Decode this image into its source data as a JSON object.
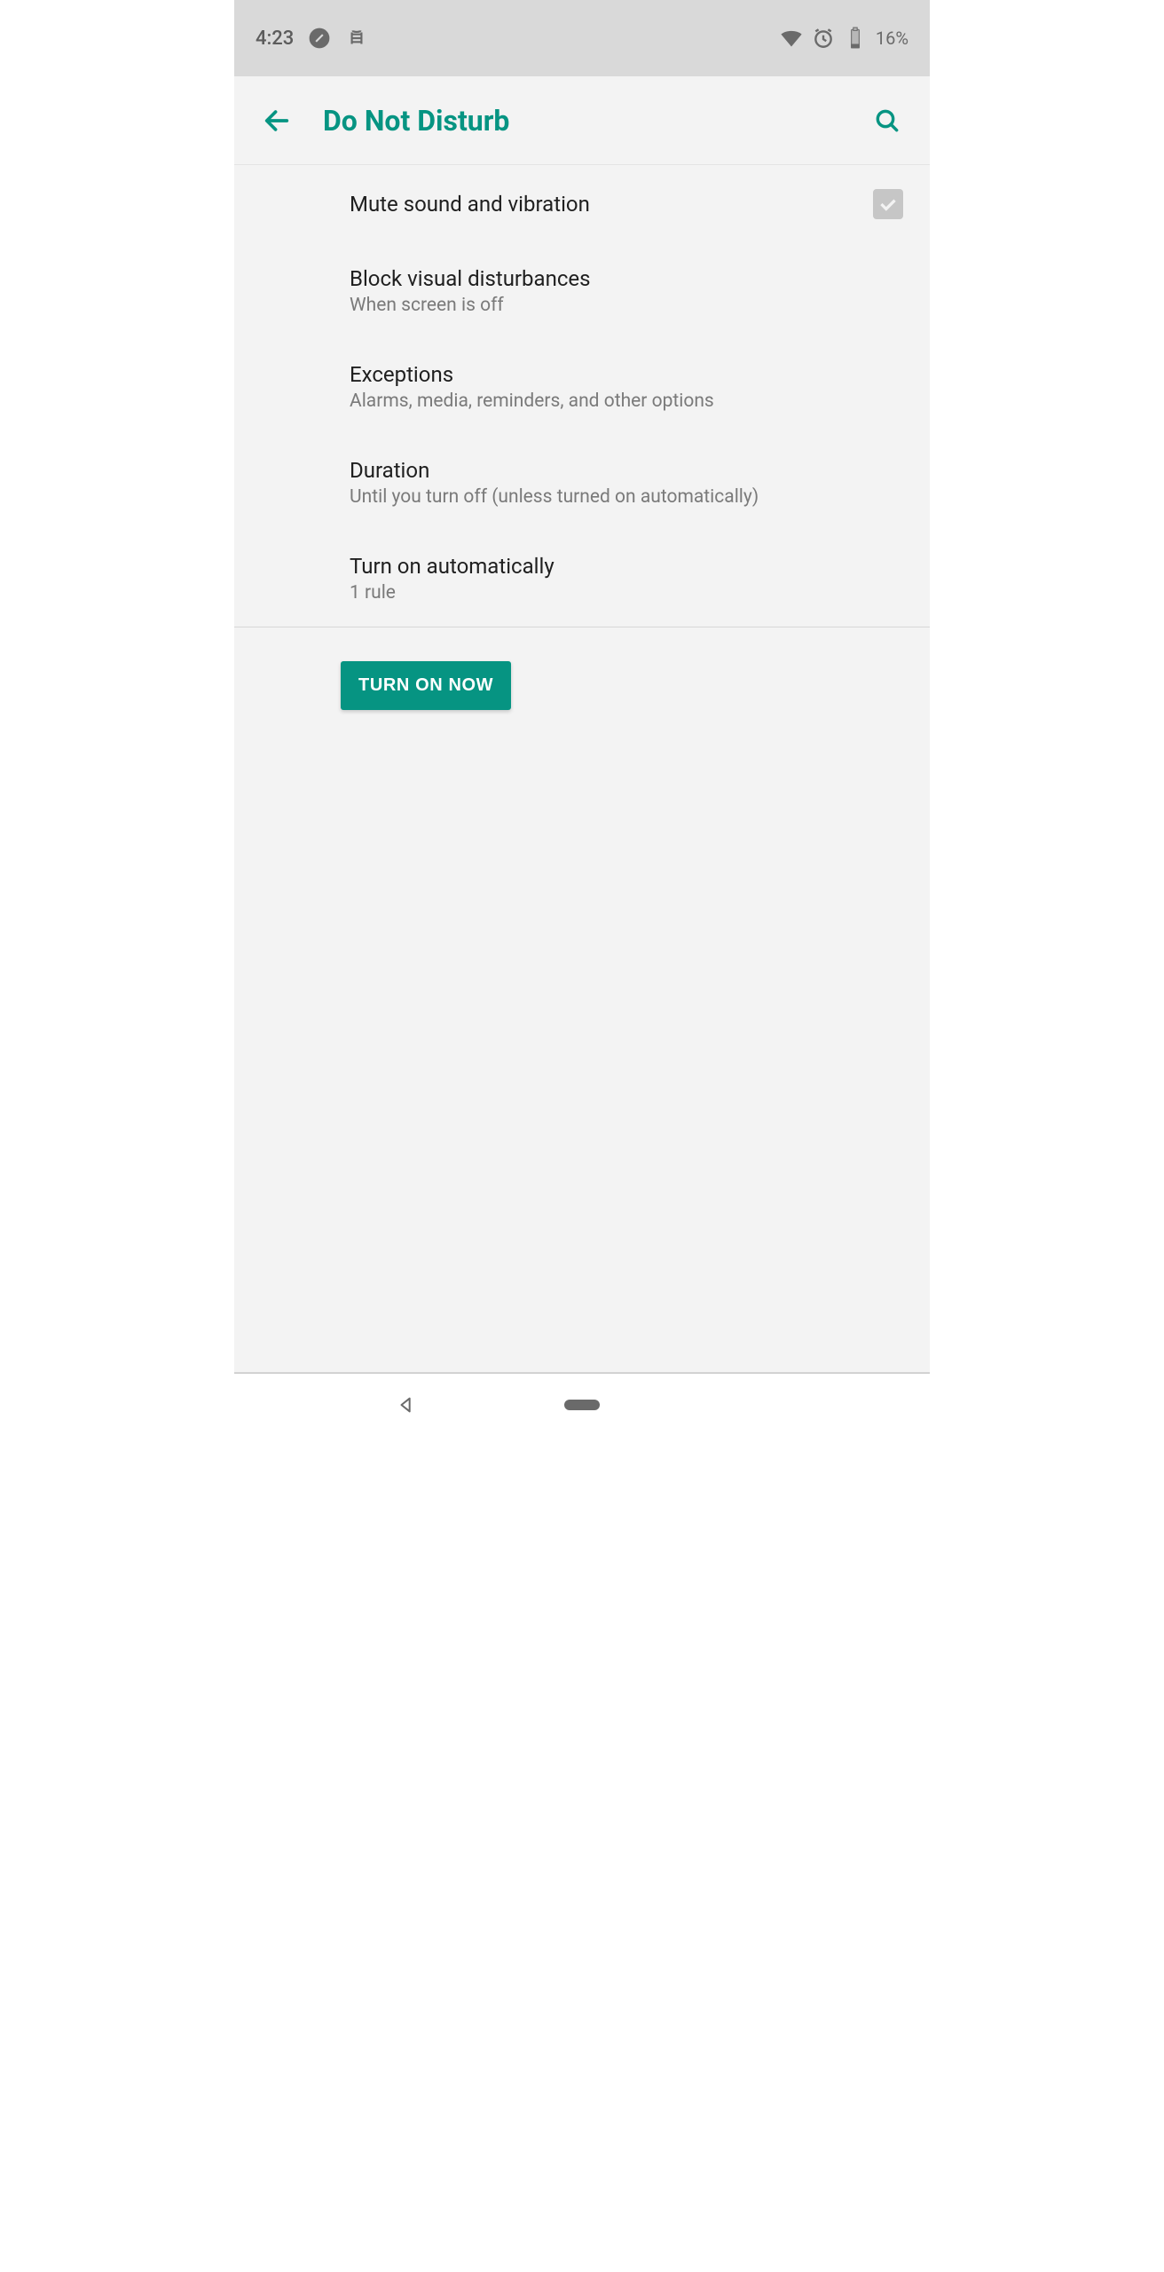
{
  "status": {
    "time": "4:23",
    "battery_percent": "16%"
  },
  "appbar": {
    "title": "Do Not Disturb"
  },
  "rows": [
    {
      "title": "Mute sound and vibration",
      "subtitle": null,
      "has_checkbox": true
    },
    {
      "title": "Block visual disturbances",
      "subtitle": "When screen is off"
    },
    {
      "title": "Exceptions",
      "subtitle": "Alarms, media, reminders, and other options"
    },
    {
      "title": "Duration",
      "subtitle": "Until you turn off (unless turned on automatically)"
    },
    {
      "title": "Turn on automatically",
      "subtitle": "1 rule"
    }
  ],
  "buttons": {
    "turn_on_now": "TURN ON NOW"
  },
  "colors": {
    "accent": "#069482"
  }
}
